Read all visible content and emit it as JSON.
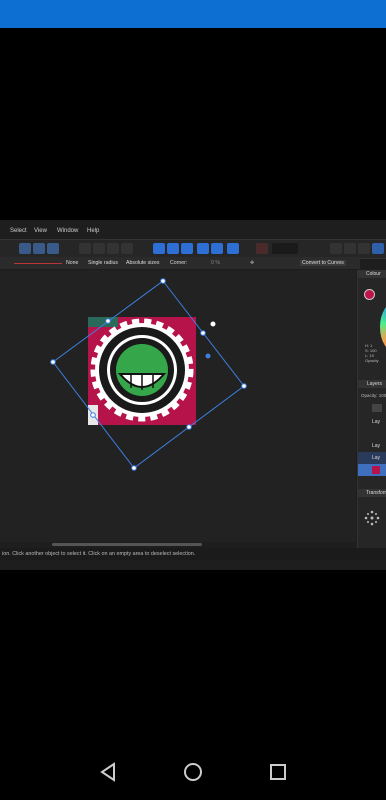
{
  "menu": {
    "select": "Select",
    "view": "View",
    "window": "Window",
    "help": "Help"
  },
  "context": {
    "none": "None",
    "single_radius": "Single radius",
    "absolute_sizes": "Absolute sizes",
    "corner": "Corner:",
    "percent": "0 %",
    "convert": "Convert to Curves"
  },
  "panel": {
    "colour": "Colour",
    "h": "H: 1",
    "s": "S: 100",
    "l": "L: 19",
    "opacity": "Opacity",
    "layers": "Layers",
    "layers_opacity": "Opacity:",
    "opacity_val": "100",
    "layer_label": "Lay",
    "transform": "Transform"
  },
  "status": {
    "hint": "ion. Click another object to select it. Click on an empty area to deselect selection."
  },
  "colors": {
    "statusbar": "#0d6fd1",
    "emblem_red": "#b5134a",
    "emblem_green": "#36a64a",
    "handle": "#3d7fe0"
  }
}
